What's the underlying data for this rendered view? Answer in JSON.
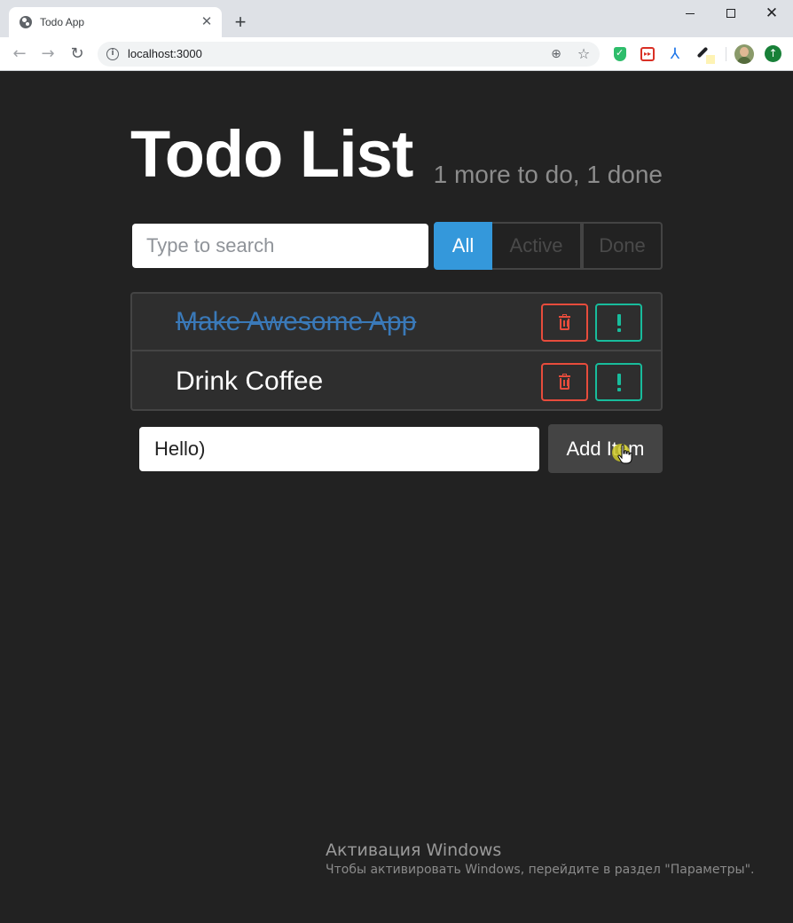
{
  "browser": {
    "tab_title": "Todo App",
    "tab_close_glyph": "✕",
    "new_tab_glyph": "+",
    "address": "localhost:3000",
    "icons": [
      "globe-icon",
      "back-icon",
      "forward-icon",
      "reload-icon",
      "info-icon",
      "zoom-icon",
      "star-icon",
      "shield-extension-icon",
      "red-extension-icon",
      "acrobat-extension-icon",
      "color-picker-extension-icon",
      "avatar",
      "update-icon"
    ]
  },
  "app": {
    "title": "Todo List",
    "status": "1 more to do, 1 done",
    "search": {
      "placeholder": "Type to search",
      "value": ""
    },
    "filters": [
      {
        "label": "All",
        "selected": true
      },
      {
        "label": "Active",
        "selected": false
      },
      {
        "label": "Done",
        "selected": false
      }
    ],
    "items": [
      {
        "label": "Make Awesome App",
        "done": true,
        "important": false
      },
      {
        "label": "Drink Coffee",
        "done": false,
        "important": false
      }
    ],
    "add_form": {
      "value": "Hello)",
      "button_label": "Add Item"
    }
  },
  "watermark": {
    "title": "Активация Windows",
    "subtitle": "Чтобы активировать Windows, перейдите в раздел \"Параметры\"."
  },
  "colors": {
    "background": "#222222",
    "primary": "#3498db",
    "danger": "#e74c3c",
    "success": "#18bc9c",
    "done_text": "#3a79b8",
    "muted": "#8c8c8c"
  }
}
